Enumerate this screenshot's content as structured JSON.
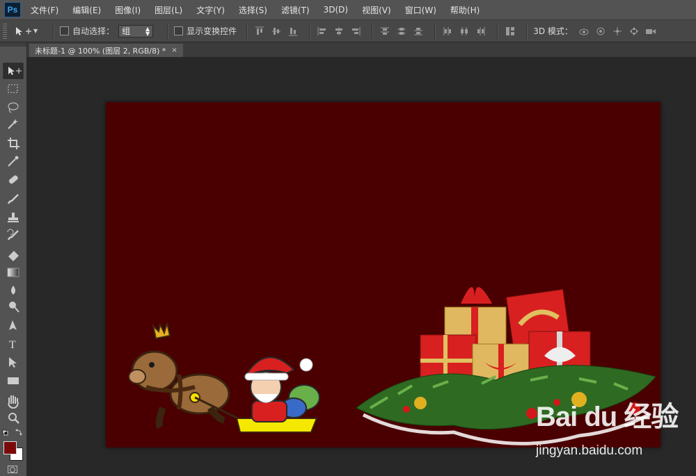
{
  "app": {
    "logo": "Ps"
  },
  "menu": [
    {
      "label": "文件(F)"
    },
    {
      "label": "编辑(E)"
    },
    {
      "label": "图像(I)"
    },
    {
      "label": "图层(L)"
    },
    {
      "label": "文字(Y)"
    },
    {
      "label": "选择(S)"
    },
    {
      "label": "滤镜(T)"
    },
    {
      "label": "3D(D)"
    },
    {
      "label": "视图(V)"
    },
    {
      "label": "窗口(W)"
    },
    {
      "label": "帮助(H)"
    }
  ],
  "options": {
    "auto_select_label": "自动选择：",
    "auto_select_checked": false,
    "auto_select_value": "组",
    "show_transform_label": "显示变换控件",
    "show_transform_checked": false,
    "mode3d_label": "3D 模式："
  },
  "document": {
    "tab_title": "未标题-1 @ 100% (图层 2, RGB/8) *",
    "close_glyph": "×",
    "background_color": "#4a0000"
  },
  "toolbar": {
    "foreground_color": "#7a0a0a",
    "background_color": "#ffffff",
    "tools": [
      {
        "name": "move-tool",
        "glyph": "▸✥",
        "active": true
      },
      {
        "name": "marquee-tool",
        "glyph": "⬚"
      },
      {
        "name": "lasso-tool",
        "glyph": "ʘ"
      },
      {
        "name": "magic-wand-tool",
        "glyph": "✲"
      },
      {
        "name": "crop-tool",
        "glyph": "⌗"
      },
      {
        "name": "eyedropper-tool",
        "glyph": "✎"
      },
      {
        "name": "healing-brush-tool",
        "glyph": "✚"
      },
      {
        "name": "brush-tool",
        "glyph": "⁄"
      },
      {
        "name": "clone-stamp-tool",
        "glyph": "⊥"
      },
      {
        "name": "history-brush-tool",
        "glyph": "↺"
      },
      {
        "name": "eraser-tool",
        "glyph": "◩"
      },
      {
        "name": "gradient-tool",
        "glyph": "▭"
      },
      {
        "name": "blur-tool",
        "glyph": "●"
      },
      {
        "name": "dodge-tool",
        "glyph": "◖"
      },
      {
        "name": "pen-tool",
        "glyph": "✒"
      },
      {
        "name": "type-tool",
        "glyph": "T"
      },
      {
        "name": "path-selection-tool",
        "glyph": "▶"
      },
      {
        "name": "rectangle-tool",
        "glyph": "▬"
      },
      {
        "name": "hand-tool",
        "glyph": "✋"
      },
      {
        "name": "zoom-tool",
        "glyph": "⚲"
      }
    ]
  },
  "watermark": {
    "logo": "Bai du 经验",
    "url": "jingyan.baidu.com"
  }
}
